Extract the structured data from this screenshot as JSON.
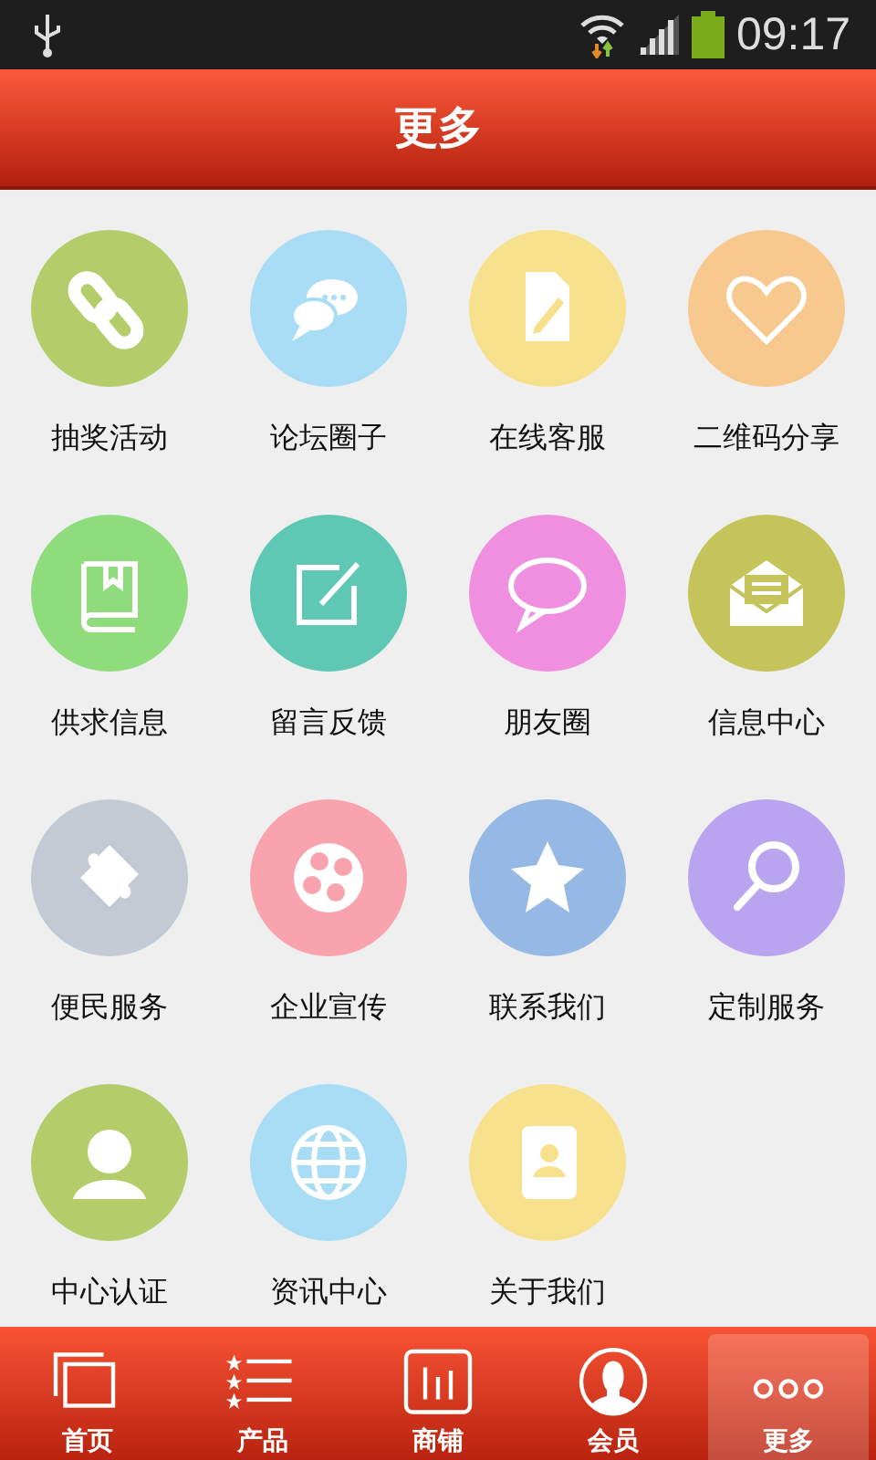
{
  "status_bar": {
    "time": "09:17"
  },
  "header": {
    "title": "更多"
  },
  "grid": [
    {
      "label": "抽奖活动",
      "color": "#b5cc6a"
    },
    {
      "label": "论坛圈子",
      "color": "#a9dcf5"
    },
    {
      "label": "在线客服",
      "color": "#f7e08c"
    },
    {
      "label": "二维码分享",
      "color": "#f8c98e"
    },
    {
      "label": "供求信息",
      "color": "#8edc7c"
    },
    {
      "label": "留言反馈",
      "color": "#5ec8b4"
    },
    {
      "label": "朋友圈",
      "color": "#f08fe0"
    },
    {
      "label": "信息中心",
      "color": "#c4c45a"
    },
    {
      "label": "便民服务",
      "color": "#c3cad3"
    },
    {
      "label": "企业宣传",
      "color": "#f8a3ad"
    },
    {
      "label": "联系我们",
      "color": "#95b8e4"
    },
    {
      "label": "定制服务",
      "color": "#b9a4f0"
    },
    {
      "label": "中心认证",
      "color": "#b5cc6a"
    },
    {
      "label": "资讯中心",
      "color": "#a9dcf5"
    },
    {
      "label": "关于我们",
      "color": "#f7e08c"
    }
  ],
  "bottom_nav": [
    {
      "label": "首页",
      "selected": false
    },
    {
      "label": "产品",
      "selected": false
    },
    {
      "label": "商铺",
      "selected": false
    },
    {
      "label": "会员",
      "selected": false
    },
    {
      "label": "更多",
      "selected": true
    }
  ]
}
